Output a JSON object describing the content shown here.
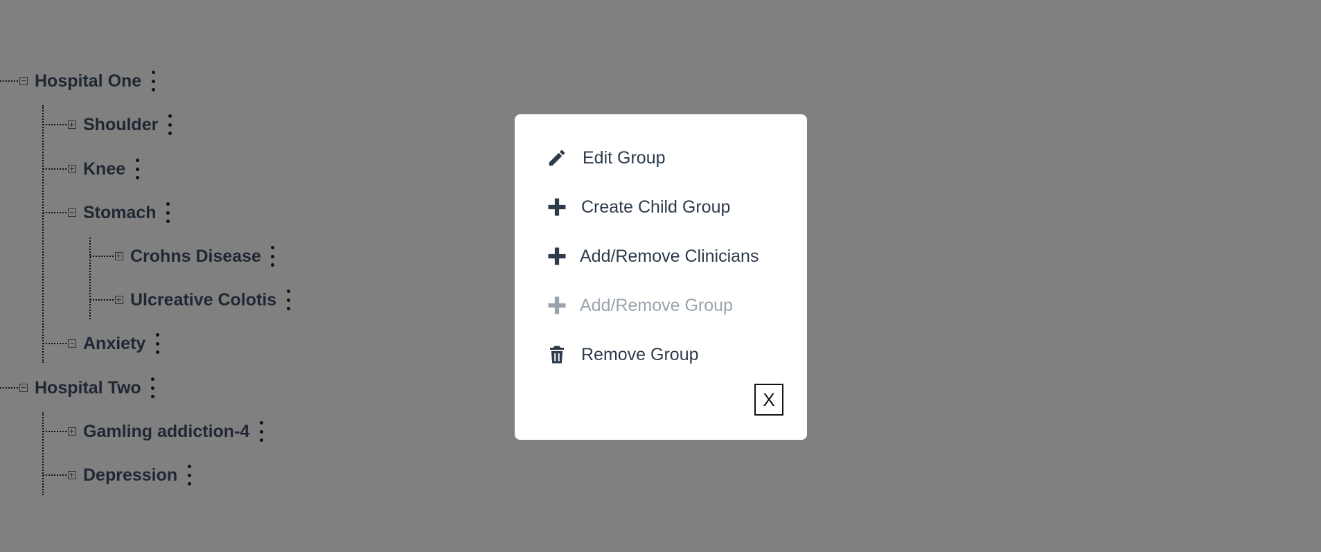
{
  "tree": {
    "nodes": [
      {
        "label": "Hospital One",
        "expanded": true
      },
      {
        "label": "Shoulder",
        "expanded": false
      },
      {
        "label": "Knee",
        "expanded": false
      },
      {
        "label": "Stomach",
        "expanded": true
      },
      {
        "label": "Crohns Disease",
        "expanded": false
      },
      {
        "label": "Ulcreative Colotis",
        "expanded": false
      },
      {
        "label": "Anxiety",
        "expanded": true
      },
      {
        "label": "Hospital Two",
        "expanded": true
      },
      {
        "label": "Gamling addiction-4",
        "expanded": false
      },
      {
        "label": "Depression",
        "expanded": false
      }
    ]
  },
  "modal": {
    "items": [
      {
        "label": "Edit Group",
        "icon": "pencil-icon",
        "disabled": false
      },
      {
        "label": "Create Child Group",
        "icon": "plus-icon",
        "disabled": false
      },
      {
        "label": "Add/Remove Clinicians",
        "icon": "plus-icon",
        "disabled": false
      },
      {
        "label": "Add/Remove Group",
        "icon": "plus-icon",
        "disabled": true
      },
      {
        "label": "Remove Group",
        "icon": "trash-icon",
        "disabled": false
      }
    ],
    "close_label": "X"
  },
  "colors": {
    "overlay": "#808080",
    "text": "#1f2733",
    "menu_text": "#2d3a4a",
    "menu_disabled": "#9aa3ad",
    "modal_bg": "#ffffff"
  }
}
